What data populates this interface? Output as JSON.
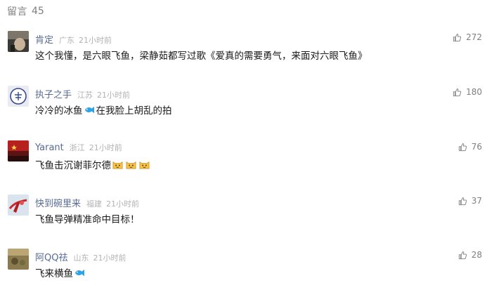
{
  "header": {
    "label": "留言",
    "count": "45"
  },
  "comments": [
    {
      "nickname": "肯定",
      "location": "广东",
      "time": "21小时前",
      "likes": "272",
      "text_parts": [
        "这个我懂，是六眼飞鱼，梁静茹都写过歌《爱真的需要勇气，来面对六眼飞鱼》"
      ]
    },
    {
      "nickname": "执子之手",
      "location": "江苏",
      "time": "21小时前",
      "likes": "180",
      "text_parts": [
        "冷冷的冰鱼",
        "在我脸上胡乱的拍"
      ]
    },
    {
      "nickname": "Yarant",
      "location": "浙江",
      "time": "21小时前",
      "likes": "76",
      "text_parts": [
        "飞鱼击沉谢菲尔德"
      ]
    },
    {
      "nickname": "快到碗里来",
      "location": "福建",
      "time": "21小时前",
      "likes": "37",
      "text_parts": [
        "飞鱼导弹精准命中目标！"
      ]
    },
    {
      "nickname": "阿QQ祛",
      "location": "山东",
      "time": "21小时前",
      "likes": "28",
      "text_parts": [
        "飞来横鱼"
      ]
    }
  ],
  "icons": {
    "like": "thumbs-up-icon",
    "fish": "fish-emoji-icon",
    "cat": "cat-emoji-icon"
  },
  "colors": {
    "nickname": "#576b95",
    "meta": "#b2b2b2",
    "fish": "#2ea2e6",
    "cat": "#f6c343"
  }
}
